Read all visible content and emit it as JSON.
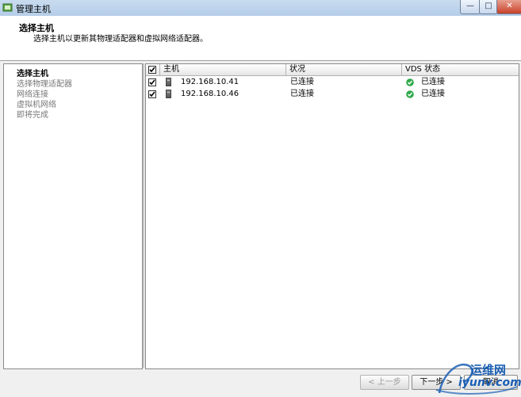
{
  "window": {
    "title": "管理主机",
    "close_symbol": "✕",
    "min_symbol": "—",
    "max_symbol": "□"
  },
  "header": {
    "title": "选择主机",
    "subtitle": "选择主机以更新其物理适配器和虚拟网络适配器。"
  },
  "nav": {
    "items": [
      {
        "label": "选择主机",
        "active": true
      },
      {
        "label": "选择物理适配器",
        "active": false
      },
      {
        "label": "网络连接",
        "active": false
      },
      {
        "label": "虚拟机网络",
        "active": false
      },
      {
        "label": "即将完成",
        "active": false
      }
    ]
  },
  "table": {
    "columns": [
      "主机",
      "状况",
      "VDS 状态"
    ],
    "rows": [
      {
        "checked": true,
        "host": "192.168.10.41",
        "status": "已连接",
        "vds_status": "已连接"
      },
      {
        "checked": true,
        "host": "192.168.10.46",
        "status": "已连接",
        "vds_status": "已连接"
      }
    ]
  },
  "buttons": {
    "back": "< 上一步",
    "next": "下一步 >",
    "cancel": "取消"
  },
  "watermark": {
    "line1": "运维网",
    "line2": "iyunv.com"
  },
  "colors": {
    "ok": "#2ea84a",
    "accent": "#1a5fb4"
  }
}
